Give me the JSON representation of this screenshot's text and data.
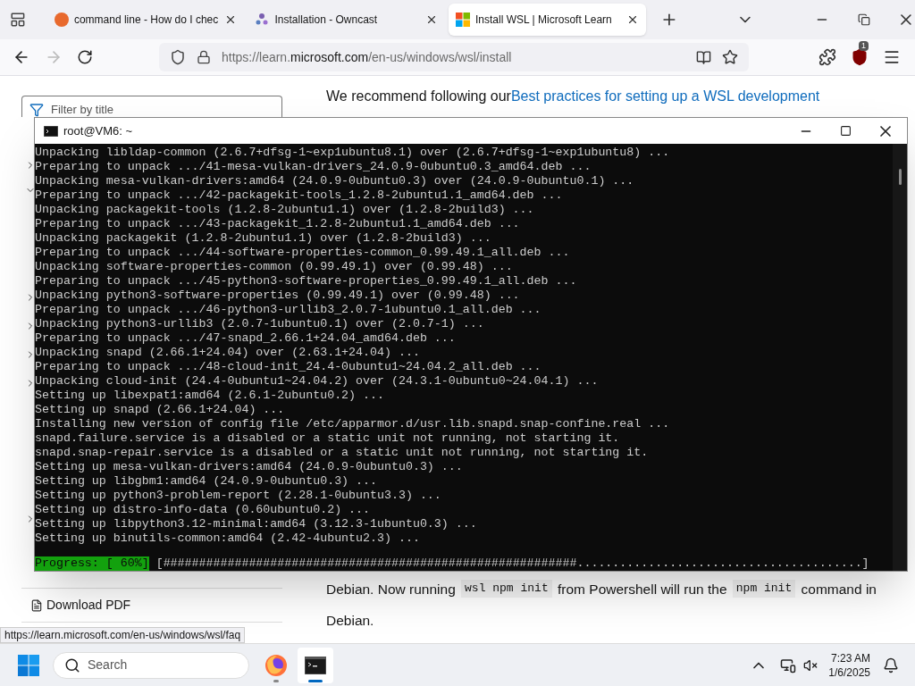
{
  "browser": {
    "tabs": [
      {
        "title": "command line - How do I chec",
        "kind": "ask",
        "selected": false
      },
      {
        "title": "Installation - Owncast",
        "kind": "owncast",
        "selected": false
      },
      {
        "title": "Install WSL | Microsoft Learn",
        "kind": "microsoft",
        "selected": true
      }
    ],
    "forward_disabled": true,
    "url": {
      "prefix": "https://learn.",
      "domain": "microsoft.com",
      "path": "/en-us/windows/wsl/install"
    },
    "extension_badge": "1"
  },
  "page": {
    "filter_placeholder": "Filter by title",
    "toc_toggles": [
      {
        "expanded": false
      },
      {
        "expanded": true
      },
      {
        "expanded": false
      },
      {
        "expanded": false
      },
      {
        "expanded": false
      },
      {
        "expanded": false
      },
      {
        "expanded": false
      }
    ],
    "download": "Download PDF",
    "intro": {
      "text": "We recommend following our ",
      "link": "Best practices for setting up a WSL development"
    },
    "paragraph_line": [
      {
        "kind": "text",
        "text": "Debian. Now running "
      },
      {
        "kind": "code",
        "text": "wsl npm init"
      },
      {
        "kind": "text",
        "text": " from Powershell will run the "
      },
      {
        "kind": "code",
        "text": "npm init"
      },
      {
        "kind": "text",
        "text": " command in"
      }
    ],
    "paragraph_end": "Debian."
  },
  "status_link": "https://learn.microsoft.com/en-us/windows/wsl/faq",
  "terminal": {
    "title": "root@VM6: ~",
    "lines": [
      "Unpacking libldap-common (2.6.7+dfsg-1~exp1ubuntu8.1) over (2.6.7+dfsg-1~exp1ubuntu8) ...",
      "Preparing to unpack .../41-mesa-vulkan-drivers_24.0.9-0ubuntu0.3_amd64.deb ...",
      "Unpacking mesa-vulkan-drivers:amd64 (24.0.9-0ubuntu0.3) over (24.0.9-0ubuntu0.1) ...",
      "Preparing to unpack .../42-packagekit-tools_1.2.8-2ubuntu1.1_amd64.deb ...",
      "Unpacking packagekit-tools (1.2.8-2ubuntu1.1) over (1.2.8-2build3) ...",
      "Preparing to unpack .../43-packagekit_1.2.8-2ubuntu1.1_amd64.deb ...",
      "Unpacking packagekit (1.2.8-2ubuntu1.1) over (1.2.8-2build3) ...",
      "Preparing to unpack .../44-software-properties-common_0.99.49.1_all.deb ...",
      "Unpacking software-properties-common (0.99.49.1) over (0.99.48) ...",
      "Preparing to unpack .../45-python3-software-properties_0.99.49.1_all.deb ...",
      "Unpacking python3-software-properties (0.99.49.1) over (0.99.48) ...",
      "Preparing to unpack .../46-python3-urllib3_2.0.7-1ubuntu0.1_all.deb ...",
      "Unpacking python3-urllib3 (2.0.7-1ubuntu0.1) over (2.0.7-1) ...",
      "Preparing to unpack .../47-snapd_2.66.1+24.04_amd64.deb ...",
      "Unpacking snapd (2.66.1+24.04) over (2.63.1+24.04) ...",
      "Preparing to unpack .../48-cloud-init_24.4-0ubuntu1~24.04.2_all.deb ...",
      "Unpacking cloud-init (24.4-0ubuntu1~24.04.2) over (24.3.1-0ubuntu0~24.04.1) ...",
      "Setting up libexpat1:amd64 (2.6.1-2ubuntu0.2) ...",
      "Setting up snapd (2.66.1+24.04) ...",
      "Installing new version of config file /etc/apparmor.d/usr.lib.snapd.snap-confine.real ...",
      "snapd.failure.service is a disabled or a static unit not running, not starting it.",
      "snapd.snap-repair.service is a disabled or a static unit not running, not starting it.",
      "Setting up mesa-vulkan-drivers:amd64 (24.0.9-0ubuntu0.3) ...",
      "Setting up libgbm1:amd64 (24.0.9-0ubuntu0.3) ...",
      "Setting up python3-problem-report (2.28.1-0ubuntu3.3) ...",
      "Setting up distro-info-data (0.60ubuntu0.2) ...",
      "Setting up libpython3.12-minimal:amd64 (3.12.3-1ubuntu0.3) ...",
      "Setting up binutils-common:amd64 (2.42-4ubuntu2.3) ..."
    ],
    "progress_label": "Progress: [ 60%]",
    "progress_bar": "[##########################################################........................................]"
  },
  "taskbar": {
    "search_placeholder": "Search",
    "apps": [
      {
        "kind": "firefox",
        "selected": false
      },
      {
        "kind": "terminal",
        "selected": true
      }
    ],
    "time": "7:23 AM",
    "date": "1/6/2025"
  }
}
